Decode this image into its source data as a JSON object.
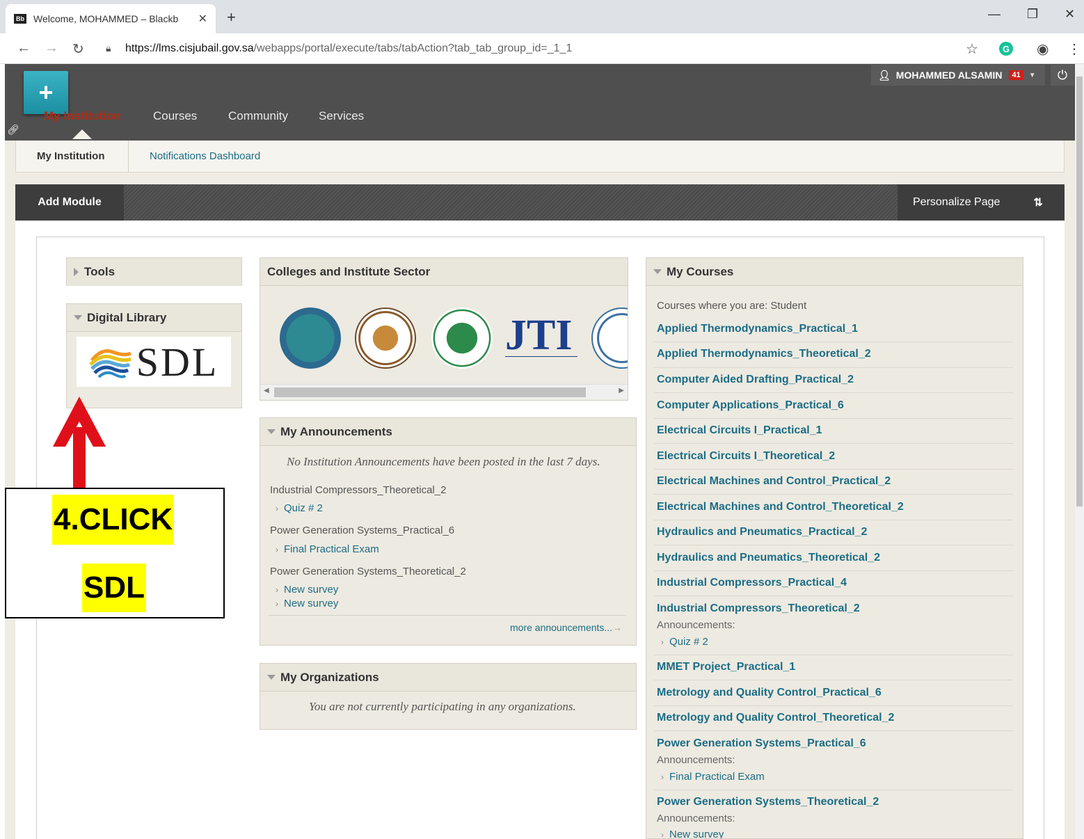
{
  "browser": {
    "tab_title": "Welcome, MOHAMMED – Blackb",
    "tab_favicon": "Bb",
    "url_host": "https://lms.cisjubail.gov.sa",
    "url_path": "/webapps/portal/execute/tabs/tabAction?tab_tab_group_id=_1_1"
  },
  "header": {
    "user_name": "MOHAMMED ALSAMIN",
    "notification_count": "41",
    "nav": [
      "My Institution",
      "Courses",
      "Community",
      "Services"
    ]
  },
  "subnav": {
    "tabs": [
      "My Institution",
      "Notifications Dashboard"
    ]
  },
  "actionbar": {
    "add_module": "Add Module",
    "personalize": "Personalize Page"
  },
  "modules": {
    "tools": "Tools",
    "digital_library": "Digital Library",
    "sdl_logo": "SDL",
    "colleges": "Colleges and Institute Sector",
    "announcements": {
      "title": "My Announcements",
      "empty": "No Institution Announcements have been posted in the last 7 days.",
      "groups": [
        {
          "course": "Industrial Compressors_Theoretical_2",
          "items": [
            "Quiz # 2"
          ]
        },
        {
          "course": "Power Generation Systems_Practical_6",
          "items": [
            "Final Practical Exam"
          ]
        },
        {
          "course": "Power Generation Systems_Theoretical_2",
          "items": [
            "New survey",
            "New survey"
          ]
        }
      ],
      "more": "more announcements..."
    },
    "organizations": {
      "title": "My Organizations",
      "empty": "You are not currently participating in any organizations."
    },
    "my_courses": {
      "title": "My Courses",
      "label": "Courses where you are: Student",
      "courses": [
        "Applied Thermodynamics_Practical_1",
        "Applied Thermodynamics_Theoretical_2",
        "Computer Aided Drafting_Practical_2",
        "Computer Applications_Practical_6",
        "Electrical Circuits I_Practical_1",
        "Electrical Circuits I_Theoretical_2",
        "Electrical Machines and Control_Practical_2",
        "Electrical Machines and Control_Theoretical_2",
        "Hydraulics and Pneumatics_Practical_2",
        "Hydraulics and Pneumatics_Theoretical_2",
        "Industrial Compressors_Practical_4",
        "Industrial Compressors_Theoretical_2",
        "MMET Project_Practical_1",
        "Metrology and Quality Control_Practical_6",
        "Metrology and Quality Control_Theoretical_2",
        "Power Generation Systems_Practical_6",
        "Power Generation Systems_Theoretical_2"
      ],
      "announcements_label": "Announcements:",
      "ann_items": [
        "Quiz # 2",
        "Final Practical Exam",
        "New survey"
      ]
    }
  },
  "callout": {
    "line1": "4.CLICK",
    "line2": "SDL"
  },
  "colors": {
    "accent": "#1c6d86",
    "header_bg": "#4f4f4f",
    "active_nav": "#b22b14",
    "highlight": "#ffff00",
    "arrow": "#e0101a"
  }
}
